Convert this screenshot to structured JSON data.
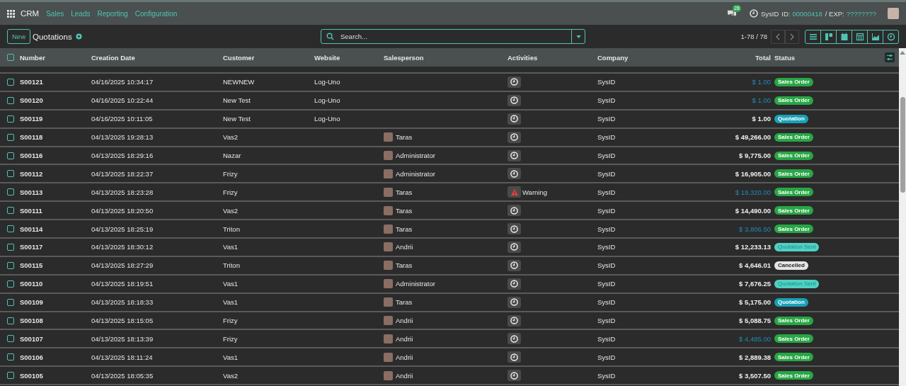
{
  "navbar": {
    "app": "CRM",
    "menu": [
      "Sales",
      "Leads",
      "Reporting",
      "Configuration"
    ],
    "chat_count": "28",
    "sysid_label": "SysID",
    "id_label": "ID:",
    "id_value": "00000418",
    "exp_label": "/ EXP:",
    "exp_value": "????????"
  },
  "control_panel": {
    "new_button": "New",
    "title": "Quotations",
    "search": {
      "placeholder": "Search..."
    },
    "pager": "1-78 / 78"
  },
  "table": {
    "columns": [
      "Number",
      "Creation Date",
      "Customer",
      "Website",
      "Salesperson",
      "Activities",
      "Company",
      "Total",
      "Status"
    ],
    "select_all_checked": false,
    "rows": [
      {
        "checked": false,
        "number": "S00121",
        "date": "04/16/2025 10:34:17",
        "customer": "NEWNEW",
        "website": "Log-Uno",
        "salesperson": "",
        "activity": {
          "kind": "clock"
        },
        "company": "SysID",
        "total": "$ 1.00",
        "muted_total": true,
        "status": {
          "label": "Sales Order",
          "kind": "sales_order"
        }
      },
      {
        "checked": false,
        "number": "S00120",
        "date": "04/16/2025 10:22:44",
        "customer": "New Test",
        "website": "Log-Uno",
        "salesperson": "",
        "activity": {
          "kind": "clock"
        },
        "company": "SysID",
        "total": "$ 1.00",
        "muted_total": true,
        "status": {
          "label": "Sales Order",
          "kind": "sales_order"
        }
      },
      {
        "checked": false,
        "number": "S00119",
        "date": "04/16/2025 10:11:05",
        "customer": "New Test",
        "website": "Log-Uno",
        "salesperson": "",
        "activity": {
          "kind": "clock"
        },
        "company": "SysID",
        "total": "$ 1.00",
        "muted_total": false,
        "status": {
          "label": "Quotation",
          "kind": "quotation"
        }
      },
      {
        "checked": false,
        "number": "S00118",
        "date": "04/13/2025 19:28:13",
        "customer": "Vas2",
        "website": "",
        "salesperson": "Taras",
        "activity": {
          "kind": "clock"
        },
        "company": "SysID",
        "total": "$ 49,266.00",
        "muted_total": false,
        "status": {
          "label": "Sales Order",
          "kind": "sales_order"
        }
      },
      {
        "checked": false,
        "number": "S00116",
        "date": "04/13/2025 18:29:16",
        "customer": "Nazar",
        "website": "",
        "salesperson": "Administrator",
        "activity": {
          "kind": "clock"
        },
        "company": "SysID",
        "total": "$ 9,775.00",
        "muted_total": false,
        "status": {
          "label": "Sales Order",
          "kind": "sales_order"
        }
      },
      {
        "checked": false,
        "number": "S00112",
        "date": "04/13/2025 18:22:37",
        "customer": "Frizy",
        "website": "",
        "salesperson": "Administrator",
        "activity": {
          "kind": "clock"
        },
        "company": "SysID",
        "total": "$ 16,905.00",
        "muted_total": false,
        "status": {
          "label": "Sales Order",
          "kind": "sales_order"
        }
      },
      {
        "checked": false,
        "number": "S00113",
        "date": "04/13/2025 18:23:28",
        "customer": "Frizy",
        "website": "",
        "salesperson": "Taras",
        "activity": {
          "kind": "warning",
          "label": "Warning"
        },
        "company": "SysID",
        "total": "$ 19,320.00",
        "muted_total": true,
        "status": {
          "label": "Sales Order",
          "kind": "sales_order"
        }
      },
      {
        "checked": false,
        "number": "S00111",
        "date": "04/13/2025 18:20:50",
        "customer": "Vas2",
        "website": "",
        "salesperson": "Taras",
        "activity": {
          "kind": "clock"
        },
        "company": "SysID",
        "total": "$ 14,490.00",
        "muted_total": false,
        "status": {
          "label": "Sales Order",
          "kind": "sales_order"
        }
      },
      {
        "checked": false,
        "number": "S00114",
        "date": "04/13/2025 18:25:19",
        "customer": "Triton",
        "website": "",
        "salesperson": "Taras",
        "activity": {
          "kind": "clock"
        },
        "company": "SysID",
        "total": "$ 3,806.50",
        "muted_total": true,
        "status": {
          "label": "Sales Order",
          "kind": "sales_order"
        }
      },
      {
        "checked": false,
        "number": "S00117",
        "date": "04/13/2025 18:30:12",
        "customer": "Vas1",
        "website": "",
        "salesperson": "Andrii",
        "activity": {
          "kind": "clock"
        },
        "company": "SysID",
        "total": "$ 12,233.13",
        "muted_total": false,
        "status": {
          "label": "Quotation Sent",
          "kind": "quotation_sent"
        }
      },
      {
        "checked": false,
        "number": "S00115",
        "date": "04/13/2025 18:27:29",
        "customer": "Triton",
        "website": "",
        "salesperson": "Taras",
        "activity": {
          "kind": "clock"
        },
        "company": "SysID",
        "total": "$ 4,646.01",
        "muted_total": false,
        "status": {
          "label": "Cancelled",
          "kind": "cancelled"
        }
      },
      {
        "checked": false,
        "number": "S00110",
        "date": "04/13/2025 18:19:51",
        "customer": "Vas1",
        "website": "",
        "salesperson": "Administrator",
        "activity": {
          "kind": "clock"
        },
        "company": "SysID",
        "total": "$ 7,676.25",
        "muted_total": false,
        "status": {
          "label": "Quotation Sent",
          "kind": "quotation_sent"
        }
      },
      {
        "checked": false,
        "number": "S00109",
        "date": "04/13/2025 18:18:33",
        "customer": "Vas1",
        "website": "",
        "salesperson": "Taras",
        "activity": {
          "kind": "clock"
        },
        "company": "SysID",
        "total": "$ 5,175.00",
        "muted_total": false,
        "status": {
          "label": "Quotation",
          "kind": "quotation"
        }
      },
      {
        "checked": false,
        "number": "S00108",
        "date": "04/13/2025 18:15:05",
        "customer": "Frizy",
        "website": "",
        "salesperson": "Andrii",
        "activity": {
          "kind": "clock"
        },
        "company": "SysID",
        "total": "$ 5,088.75",
        "muted_total": false,
        "status": {
          "label": "Sales Order",
          "kind": "sales_order"
        }
      },
      {
        "checked": false,
        "number": "S00107",
        "date": "04/13/2025 18:13:39",
        "customer": "Frizy",
        "website": "",
        "salesperson": "Andrii",
        "activity": {
          "kind": "clock"
        },
        "company": "SysID",
        "total": "$ 4,485.00",
        "muted_total": true,
        "status": {
          "label": "Sales Order",
          "kind": "sales_order"
        }
      },
      {
        "checked": false,
        "number": "S00106",
        "date": "04/13/2025 18:11:24",
        "customer": "Vas1",
        "website": "",
        "salesperson": "Andrii",
        "activity": {
          "kind": "clock"
        },
        "company": "SysID",
        "total": "$ 2,889.38",
        "muted_total": false,
        "status": {
          "label": "Sales Order",
          "kind": "sales_order"
        }
      },
      {
        "checked": false,
        "number": "S00105",
        "date": "04/13/2025 18:05:35",
        "customer": "Vas2",
        "website": "",
        "salesperson": "Andrii",
        "activity": {
          "kind": "clock"
        },
        "company": "SysID",
        "total": "$ 3,507.50",
        "muted_total": false,
        "status": {
          "label": "Sales Order",
          "kind": "sales_order"
        }
      }
    ]
  }
}
